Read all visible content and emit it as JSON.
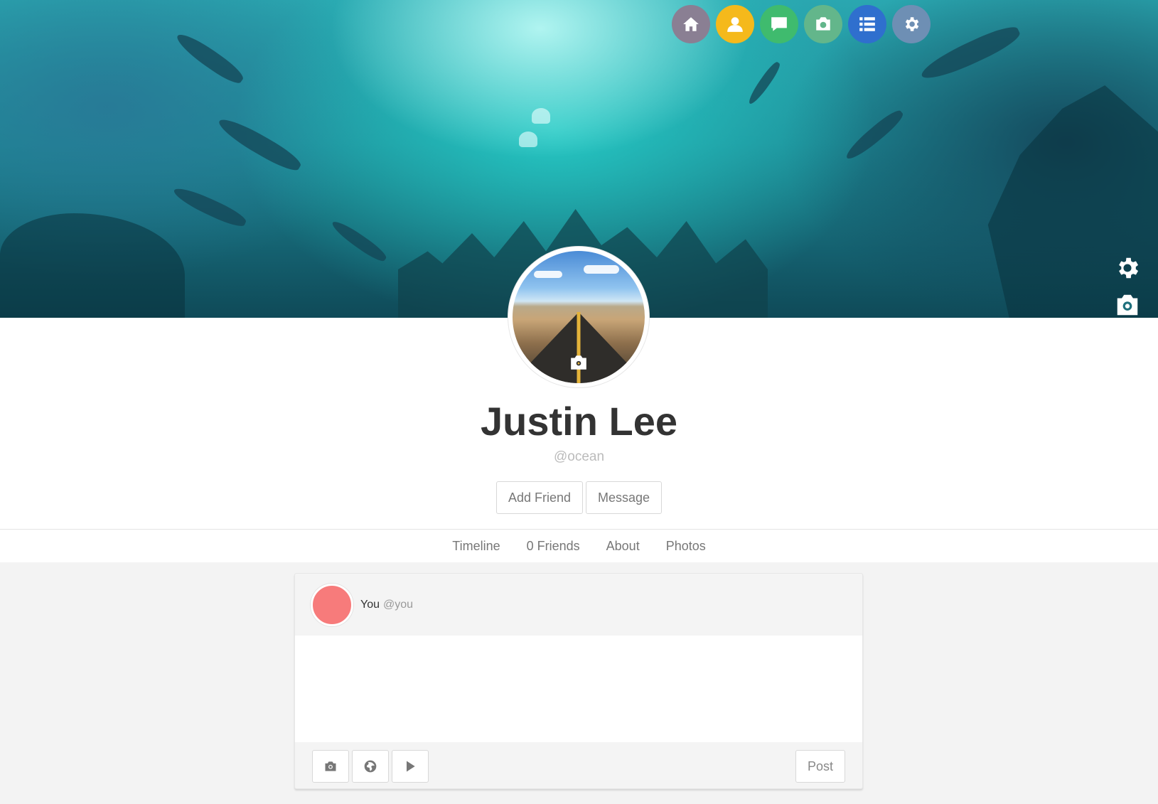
{
  "nav": {
    "items": [
      {
        "icon": "home-icon",
        "color": "#8a7f93"
      },
      {
        "icon": "user-icon",
        "color": "#f5b91b"
      },
      {
        "icon": "chat-icon",
        "color": "#3fbb6e"
      },
      {
        "icon": "camera-icon",
        "color": "#63b68b"
      },
      {
        "icon": "list-icon",
        "color": "#2f6fce"
      },
      {
        "icon": "gear-icon",
        "color": "#6e8fb4"
      }
    ]
  },
  "profile": {
    "name": "Justin Lee",
    "handle": "@ocean",
    "add_friend_label": "Add Friend",
    "message_label": "Message"
  },
  "tabs": [
    "Timeline",
    "0 Friends",
    "About",
    "Photos"
  ],
  "composer": {
    "user_name": "You",
    "user_handle": "@you",
    "avatar_color": "#f77b7b",
    "post_label": "Post"
  }
}
